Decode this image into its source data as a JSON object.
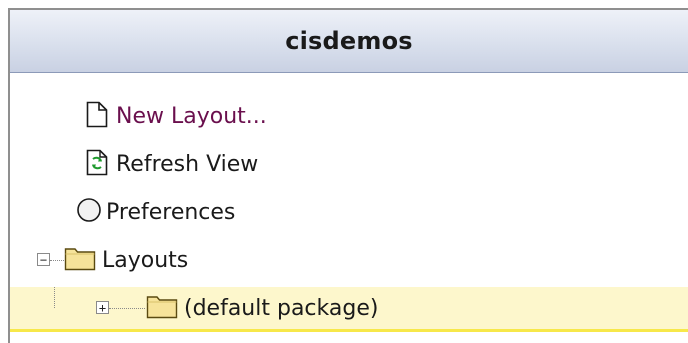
{
  "panel": {
    "title": "cisdemos"
  },
  "actions": [
    {
      "label": "New Layout...",
      "icon": "new-document-icon"
    },
    {
      "label": "Refresh View",
      "icon": "refresh-icon"
    },
    {
      "label": "Preferences",
      "icon": "preferences-circle-icon"
    }
  ],
  "tree": {
    "root": {
      "label": "Layouts",
      "expanded": true,
      "icon": "folder-icon",
      "expander": "−"
    },
    "child": {
      "label": "(default package)",
      "expanded": false,
      "selected": true,
      "icon": "folder-icon",
      "expander": "+"
    }
  },
  "colors": {
    "link_text": "#6a0f4d",
    "selection_bg": "#fdf7cc",
    "selection_border": "#f7e84a",
    "folder_fill": "#f6e39a"
  }
}
